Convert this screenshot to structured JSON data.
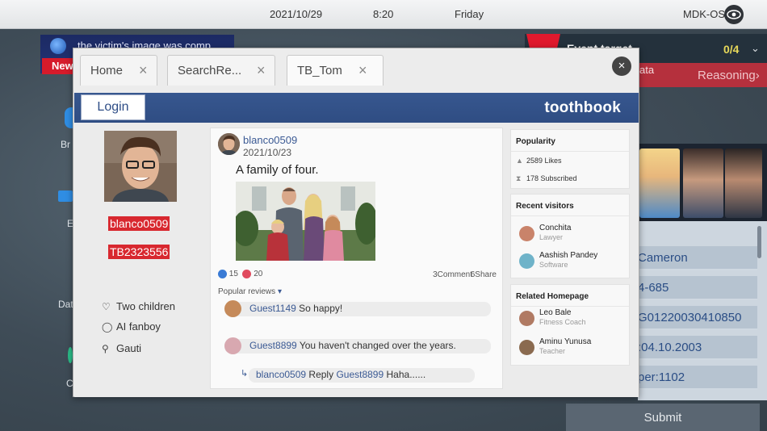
{
  "topbar": {
    "date": "2021/10/29",
    "time": "8:20",
    "day": "Friday",
    "os": "MDK-OS"
  },
  "background": {
    "news_ticker": "the victim's image was comp",
    "news_label": "New",
    "event_title": "Event target",
    "event_count": "0/4",
    "reason_data": "ata",
    "reasoning": "Reasoning",
    "left_labels": [
      "Br",
      "E",
      "Dat",
      "C"
    ],
    "right_rows": [
      "Cameron",
      "4-685",
      "G01220030410850",
      ":04.10.2003",
      "per:1102"
    ],
    "submit": "Submit"
  },
  "browser": {
    "tabs": [
      {
        "label": "Home"
      },
      {
        "label": "SearchRe..."
      },
      {
        "label": "TB_Tom"
      }
    ],
    "close": "×",
    "login": "Login",
    "logo": "toothbook"
  },
  "profile": {
    "name": "blanco0509",
    "id": "TB2323556",
    "info": [
      {
        "icon": "heart-icon",
        "text": "Two children"
      },
      {
        "icon": "ring-icon",
        "text": "AI fanboy"
      },
      {
        "icon": "location-pin-icon",
        "text": "Gauti"
      }
    ]
  },
  "post": {
    "author": "blanco0509",
    "date": "2021/10/23",
    "text": "A family of four.",
    "likes": "15",
    "hearts": "20",
    "comments": "3Comment",
    "shares": "6Share",
    "popular_label": "Popular reviews",
    "reviews": [
      {
        "user": "Guest1149",
        "text": "So happy!"
      },
      {
        "user": "Guest8899",
        "text": "You haven't changed over the years."
      }
    ],
    "reply": {
      "user": "blanco0509",
      "word": "Reply",
      "target": "Guest8899",
      "text": "Haha......"
    }
  },
  "sidebar": {
    "popularity_title": "Popularity",
    "likes": "2589 Likes",
    "subscribed": "178 Subscribed",
    "visitors_title": "Recent visitors",
    "visitors": [
      {
        "name": "Conchita",
        "role": "Lawyer",
        "color": "#c9836a"
      },
      {
        "name": "Aashish Pandey",
        "role": "Software",
        "color": "#6fb3c9"
      }
    ],
    "related_title": "Related Homepage",
    "related": [
      {
        "name": "Leo Bale",
        "role": "Fitness Coach",
        "color": "#b07a63"
      },
      {
        "name": "Aminu Yunusa",
        "role": "Teacher",
        "color": "#8a6a4f"
      }
    ]
  },
  "colors": {
    "header_blue": "#2f4d83",
    "tag_red": "#d8282f",
    "link_blue": "#3b5a94"
  }
}
